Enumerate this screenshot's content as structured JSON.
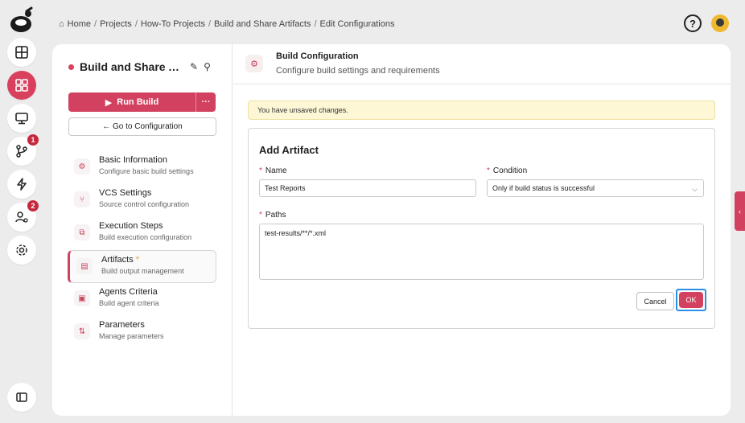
{
  "breadcrumb": [
    "Home",
    "Projects",
    "How-To Projects",
    "Build and Share Artifacts",
    "Edit Configurations"
  ],
  "rail": {
    "badges": {
      "vcs": "1",
      "agents": "2"
    }
  },
  "sidebar": {
    "project_title": "Build and Share Artifacts",
    "run_build": "Run Build",
    "more": "···",
    "goto_config": "← Go to Configuration",
    "items": [
      {
        "title": "Basic Information",
        "subtitle": "Configure basic build settings",
        "icon": "gear-icon"
      },
      {
        "title": "VCS Settings",
        "subtitle": "Source control configuration",
        "icon": "branch-icon"
      },
      {
        "title": "Execution Steps",
        "subtitle": "Build execution configuration",
        "icon": "steps-icon"
      },
      {
        "title": "Artifacts",
        "subtitle": "Build output management",
        "icon": "file-icon",
        "active": true,
        "modified": "*"
      },
      {
        "title": "Agents Criteria",
        "subtitle": "Build agent criteria",
        "icon": "agent-icon"
      },
      {
        "title": "Parameters",
        "subtitle": "Manage parameters",
        "icon": "params-icon"
      }
    ]
  },
  "panel": {
    "title": "Build Configuration",
    "subtitle": "Configure build settings and requirements",
    "warning": "You have unsaved changes.",
    "form": {
      "title": "Add Artifact",
      "name_label": "Name",
      "name_value": "Test Reports",
      "condition_label": "Condition",
      "condition_value": "Only if build status is successful",
      "paths_label": "Paths",
      "paths_value": "test-results/**/*.xml",
      "cancel": "Cancel",
      "ok": "OK"
    }
  },
  "colors": {
    "accent": "#d2415f",
    "focus": "#2d8ee6",
    "warning_bg": "#fdf7d6"
  }
}
